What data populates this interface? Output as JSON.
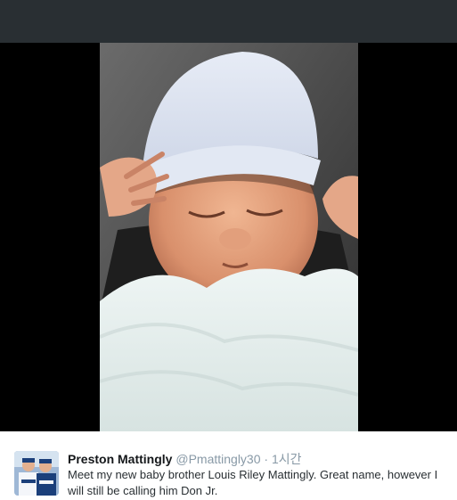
{
  "tweet": {
    "name": "Preston Mattingly",
    "handle": "@Pmattingly30",
    "separator": "·",
    "time": "1시간",
    "text": "Meet my new baby brother Louis Riley Mattingly. Great name, however I will still be calling him Don Jr."
  },
  "colors": {
    "overlay": "#292f33",
    "media_bg": "#000000",
    "card_bg": "#ffffff",
    "name": "#14171a",
    "meta": "#8899a6",
    "text": "#292f33"
  }
}
